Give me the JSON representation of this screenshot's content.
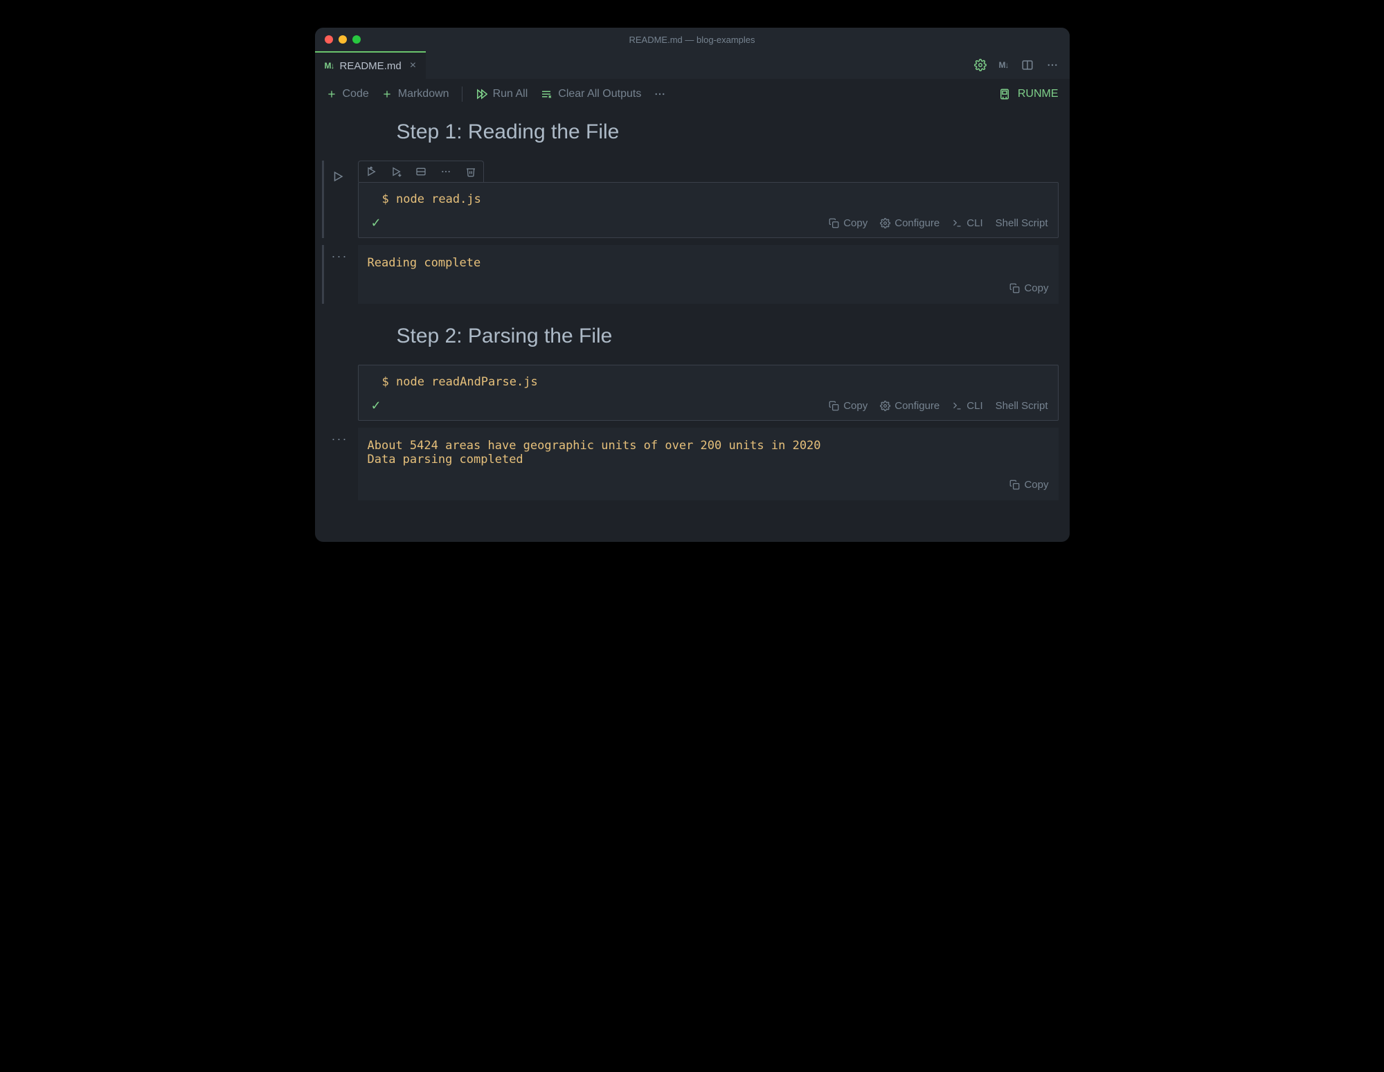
{
  "window": {
    "title": "README.md — blog-examples"
  },
  "tab": {
    "icon_name": "markdown-arrow-icon",
    "label": "README.md"
  },
  "tab_actions": {
    "md_indicator": "M↓"
  },
  "toolbar": {
    "code_label": "Code",
    "markdown_label": "Markdown",
    "run_all_label": "Run All",
    "clear_outputs_label": "Clear All Outputs",
    "runme_label": "RUNME"
  },
  "cell_actions": {
    "copy": "Copy",
    "configure": "Configure",
    "cli": "CLI",
    "shell_script": "Shell Script"
  },
  "output_actions": {
    "copy": "Copy"
  },
  "steps": [
    {
      "heading": "Step 1: Reading the File",
      "command": "node read.js",
      "output": "Reading complete",
      "focused": true,
      "show_cell_toolbar": true,
      "show_run_gutter": true
    },
    {
      "heading": "Step 2: Parsing the File",
      "command": "node readAndParse.js",
      "output": "About 5424 areas have geographic units of over 200 units in 2020\nData parsing completed",
      "focused": false,
      "show_cell_toolbar": false,
      "show_run_gutter": false
    }
  ]
}
